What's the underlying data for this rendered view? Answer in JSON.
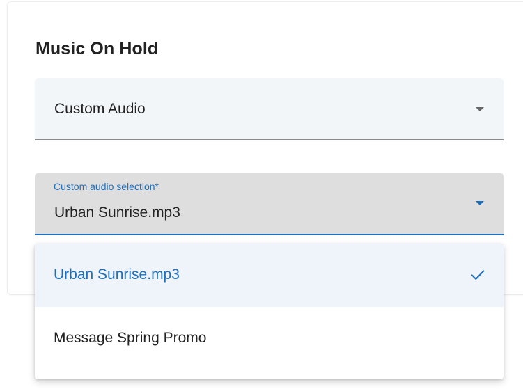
{
  "section": {
    "title": "Music On Hold"
  },
  "music_source_select": {
    "value": "Custom Audio"
  },
  "custom_audio_select": {
    "label": "Custom audio selection*",
    "value": "Urban Sunrise.mp3"
  },
  "dropdown": {
    "options": [
      {
        "label": "Urban Sunrise.mp3",
        "selected": true
      },
      {
        "label": "Message Spring Promo",
        "selected": false
      }
    ]
  },
  "colors": {
    "accent": "#1f6fbf",
    "text": "#222222",
    "field_bg": "#f3f6f9",
    "active_field_bg": "#dedede",
    "selected_option_bg": "#eef4fa"
  },
  "icons": {
    "caret": "caret-down-icon",
    "check": "check-icon"
  }
}
